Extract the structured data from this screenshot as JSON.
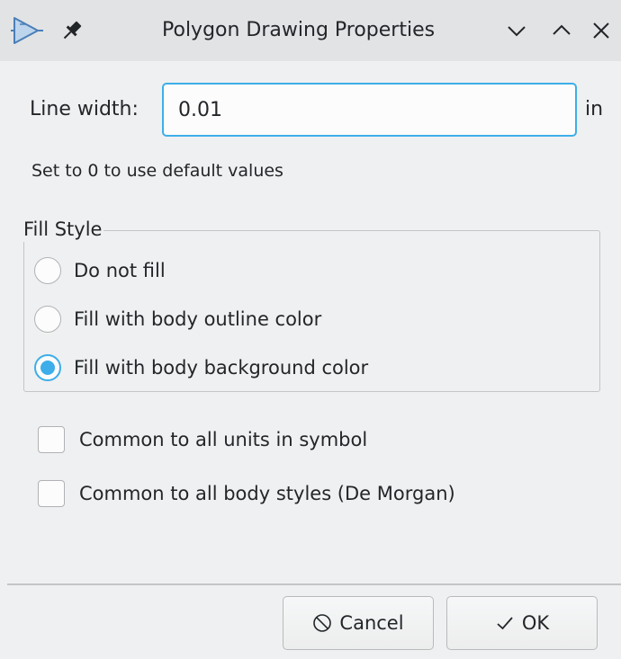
{
  "window": {
    "title": "Polygon Drawing Properties",
    "app_icon": "kicad-symbol-editor-icon",
    "pin_icon": "pin-icon",
    "controls": [
      "minimize-icon",
      "maximize-icon",
      "close-icon"
    ]
  },
  "line_width": {
    "label": "Line width:",
    "value": "0.01",
    "unit": "in",
    "hint": "Set to 0 to use default values"
  },
  "fill_style": {
    "title": "Fill Style",
    "options": [
      {
        "label": "Do not fill",
        "checked": false
      },
      {
        "label": "Fill with body outline color",
        "checked": false
      },
      {
        "label": "Fill with body background color",
        "checked": true
      }
    ]
  },
  "options": {
    "common_units": {
      "label": "Common to all units in symbol",
      "checked": false
    },
    "common_styles": {
      "label": "Common to all body styles (De Morgan)",
      "checked": false
    }
  },
  "buttons": {
    "cancel": "Cancel",
    "ok": "OK",
    "cancel_icon": "cancel-circle-icon",
    "ok_icon": "checkmark-icon"
  },
  "colors": {
    "accent": "#3daee9",
    "background": "#eff0f1",
    "text": "#232629"
  }
}
